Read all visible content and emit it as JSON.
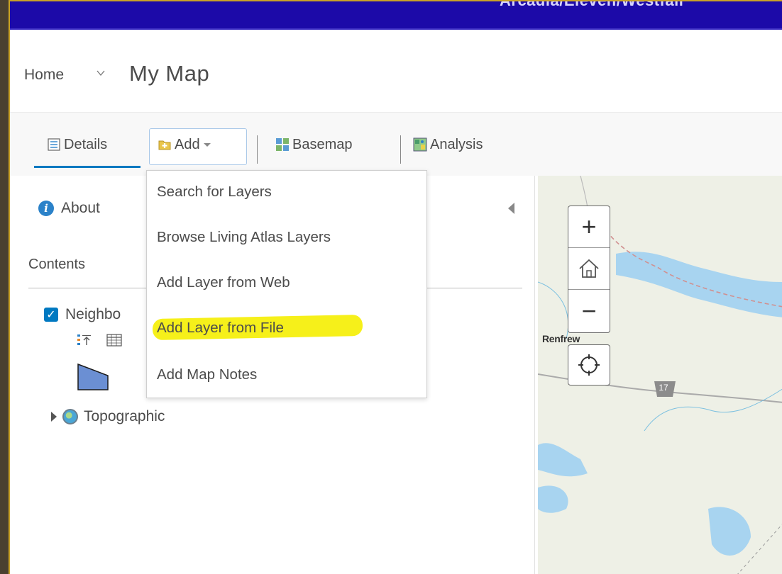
{
  "banner": {
    "partial_text": "Arcadia/Eleven/Westfall"
  },
  "header": {
    "home_label": "Home",
    "map_title": "My Map"
  },
  "toolbar": {
    "details_label": "Details",
    "add_label": "Add",
    "basemap_label": "Basemap",
    "analysis_label": "Analysis"
  },
  "add_menu": {
    "items": [
      "Search for Layers",
      "Browse Living Atlas Layers",
      "Add Layer from Web",
      "Add Layer from File",
      "Add Map Notes"
    ],
    "highlighted_item": "Add Layer from File",
    "highlight_color": "#f6f01a"
  },
  "sidebar": {
    "about_label": "About",
    "contents_label": "Contents",
    "layers": [
      {
        "label": "Neighbo",
        "checked": true
      },
      {
        "label": "Topographic",
        "checked": false
      }
    ]
  },
  "map": {
    "zoom_in": "+",
    "zoom_out": "−",
    "place_label": "Renfrew",
    "route_label": "17"
  },
  "colors": {
    "accent": "#0079c1",
    "banner": "#1c0aa8",
    "water": "#a8d4f0"
  },
  "icons": {
    "details": "details-icon",
    "add": "add-content-icon",
    "basemap": "basemap-grid-icon",
    "analysis": "analysis-icon",
    "about": "info-icon",
    "home": "home-icon",
    "locate": "locate-icon"
  }
}
